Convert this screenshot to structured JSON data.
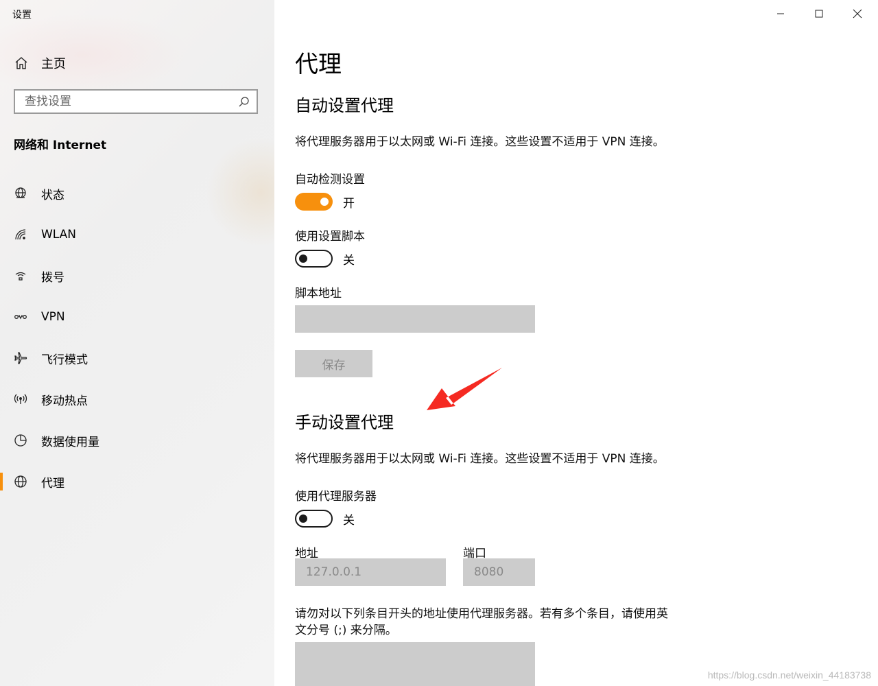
{
  "window": {
    "title": "设置",
    "controls": [
      "minimize-icon",
      "maximize-icon",
      "close-icon"
    ]
  },
  "sidebar": {
    "home_label": "主页",
    "search_placeholder": "查找设置",
    "section_title": "网络和 Internet",
    "items": [
      {
        "label": "状态",
        "icon": "globe-status-icon",
        "active": false
      },
      {
        "label": "WLAN",
        "icon": "wifi-icon",
        "active": false
      },
      {
        "label": "拨号",
        "icon": "dialup-icon",
        "active": false
      },
      {
        "label": "VPN",
        "icon": "vpn-icon",
        "active": false
      },
      {
        "label": "飞行模式",
        "icon": "airplane-icon",
        "active": false
      },
      {
        "label": "移动热点",
        "icon": "hotspot-icon",
        "active": false
      },
      {
        "label": "数据使用量",
        "icon": "pie-chart-icon",
        "active": false
      },
      {
        "label": "代理",
        "icon": "globe-icon",
        "active": true
      }
    ],
    "active_color": "#f7900d"
  },
  "main": {
    "title": "代理",
    "auto": {
      "heading": "自动设置代理",
      "description": "将代理服务器用于以太网或 Wi-Fi 连接。这些设置不适用于 VPN 连接。",
      "detect_label": "自动检测设置",
      "detect_state": "开",
      "script_label": "使用设置脚本",
      "script_state": "关",
      "address_label": "脚本地址",
      "address_value": "",
      "save_label": "保存"
    },
    "manual": {
      "heading": "手动设置代理",
      "description": "将代理服务器用于以太网或 Wi-Fi 连接。这些设置不适用于 VPN 连接。",
      "proxy_label": "使用代理服务器",
      "proxy_state": "关",
      "address_label": "地址",
      "address_value": "127.0.0.1",
      "port_label": "端口",
      "port_value": "8080",
      "exceptions_line1": "请勿对以下列条目开头的地址使用代理服务器。若有多个条目，请使用英",
      "exceptions_line2": "文分号 (;) 来分隔。",
      "exceptions_value": ""
    },
    "toggle_on_color": "#f7900d"
  },
  "annotation": {
    "arrow_color": "#f52a22"
  },
  "watermark": "https://blog.csdn.net/weixin_44183738"
}
